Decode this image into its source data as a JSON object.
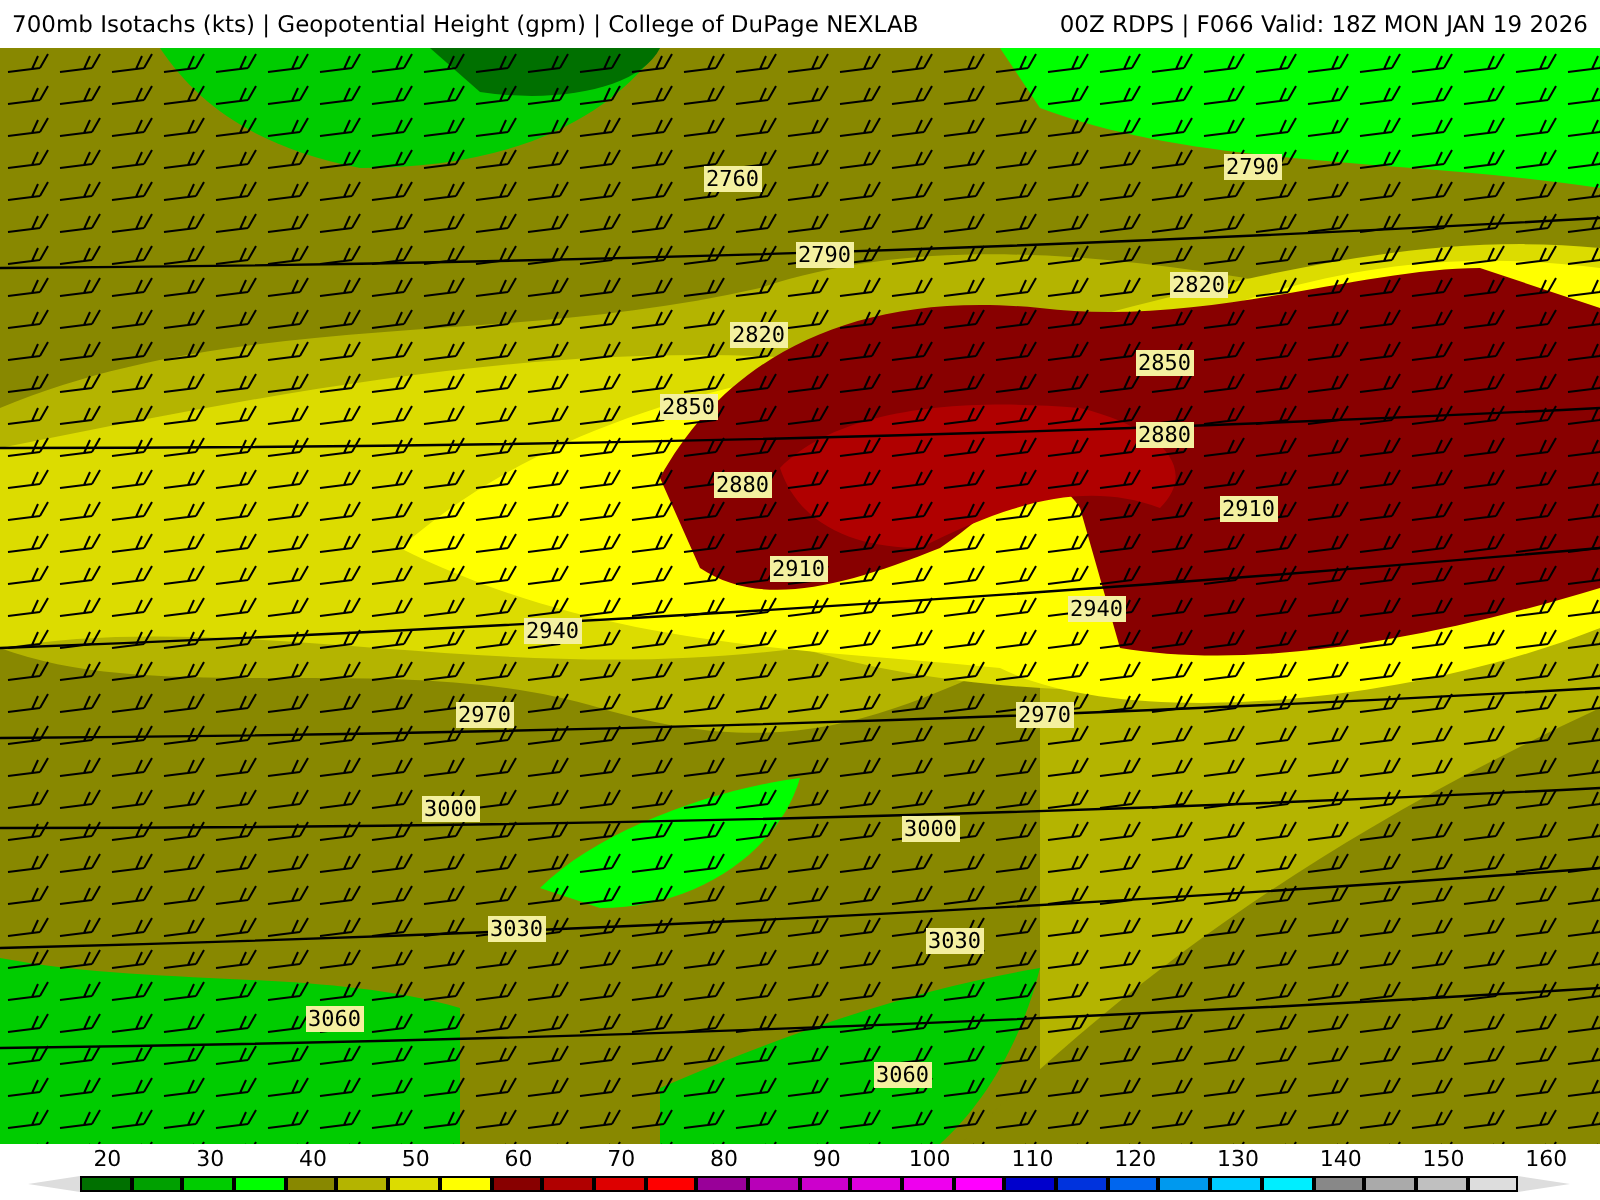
{
  "header": {
    "title": "700mb Isotachs (kts) | Geopotential Height (gpm) | College of DuPage NEXLAB",
    "run": "00Z RDPS | F066 Valid: 18Z MON JAN 19 2026"
  },
  "map": {
    "contour_labels": [
      "2760",
      "2790",
      "2790",
      "2820",
      "2820",
      "2850",
      "2850",
      "2880",
      "2880",
      "2910",
      "2910",
      "2940",
      "2940",
      "2970",
      "2970",
      "3000",
      "3000",
      "3030",
      "3030",
      "3060",
      "3060"
    ]
  },
  "legend": {
    "tick_labels": [
      "20",
      "30",
      "40",
      "50",
      "60",
      "70",
      "80",
      "90",
      "100",
      "110",
      "120",
      "130",
      "140",
      "150",
      "160"
    ],
    "swatches": [
      {
        "color": "#007000"
      },
      {
        "color": "#00a000"
      },
      {
        "color": "#00cc00"
      },
      {
        "color": "#00ff00"
      },
      {
        "color": "#888800"
      },
      {
        "color": "#b4b400"
      },
      {
        "color": "#dcdc00"
      },
      {
        "color": "#ffff00"
      },
      {
        "color": "#880000"
      },
      {
        "color": "#b00000"
      },
      {
        "color": "#dd0000"
      },
      {
        "color": "#ff0000"
      },
      {
        "color": "#990099"
      },
      {
        "color": "#b800b8"
      },
      {
        "color": "#cc00cc"
      },
      {
        "color": "#dd00dd"
      },
      {
        "color": "#ee00ee"
      },
      {
        "color": "#ff00ff"
      },
      {
        "color": "#0000cc"
      },
      {
        "color": "#0033dd"
      },
      {
        "color": "#0066ee"
      },
      {
        "color": "#0099ee"
      },
      {
        "color": "#00ccff"
      },
      {
        "color": "#00eeff"
      },
      {
        "color": "#888888"
      },
      {
        "color": "#aaaaaa"
      },
      {
        "color": "#c0c0c0"
      },
      {
        "color": "#dddddd"
      }
    ]
  }
}
